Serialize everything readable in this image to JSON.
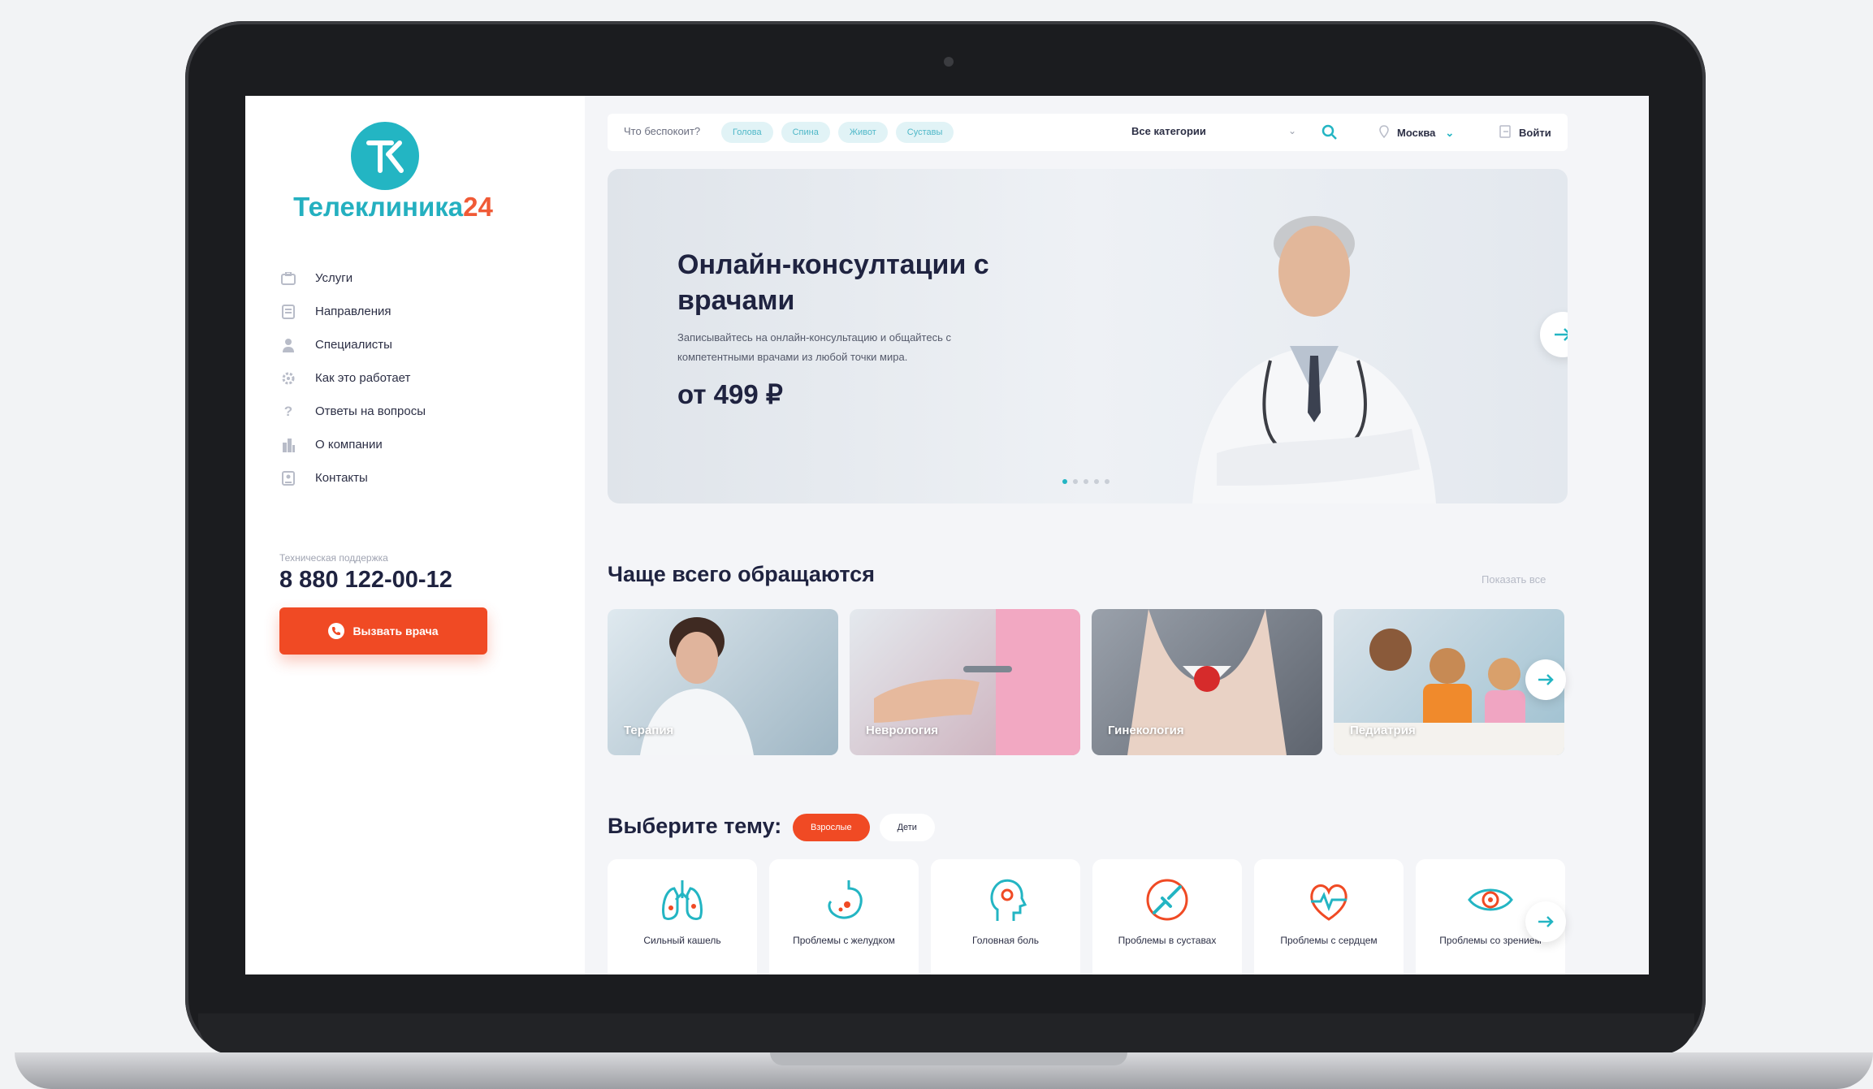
{
  "brand": {
    "name_main": "Телеклиника",
    "name_accent": "24",
    "teal": "#23b5c3",
    "orange": "#f04a24"
  },
  "sidebar": {
    "items": [
      {
        "label": "Услуги",
        "icon": "services-icon"
      },
      {
        "label": "Направления",
        "icon": "document-icon"
      },
      {
        "label": "Специалисты",
        "icon": "person-icon"
      },
      {
        "label": "Как это работает",
        "icon": "gear-icon"
      },
      {
        "label": "Ответы на вопросы",
        "icon": "question-icon"
      },
      {
        "label": "О компании",
        "icon": "building-icon"
      },
      {
        "label": "Контакты",
        "icon": "contacts-icon"
      }
    ],
    "support_label": "Техническая поддержка",
    "phone": "8 880 122-00-12",
    "call_button": "Вызвать врача"
  },
  "header": {
    "search_prompt": "Что беспокоит?",
    "chips": [
      "Голова",
      "Спина",
      "Живот",
      "Суставы"
    ],
    "category": "Все категории",
    "city": "Москва",
    "login": "Войти"
  },
  "hero": {
    "title": "Онлайн-консултации с врачами",
    "text": "Записывайтесь на онлайн-консультацию и общайтесь с компетентными врачами из любой точки мира.",
    "price": "от 499 ₽",
    "slides": 5,
    "active_slide": 1
  },
  "popular": {
    "title": "Чаще всего обращаются",
    "show_all": "Показать все",
    "cards": [
      "Терапия",
      "Неврология",
      "Гинекология",
      "Педиатрия"
    ]
  },
  "topics": {
    "title": "Выберите тему:",
    "tabs": [
      "Взрослые",
      "Дети"
    ],
    "active_tab": "Взрослые",
    "items": [
      {
        "label": "Сильный кашель",
        "icon": "lungs-icon"
      },
      {
        "label": "Проблемы с желудком",
        "icon": "stomach-icon"
      },
      {
        "label": "Головная боль",
        "icon": "head-icon"
      },
      {
        "label": "Проблемы в суставах",
        "icon": "joint-icon"
      },
      {
        "label": "Проблемы с сердцем",
        "icon": "heart-icon"
      },
      {
        "label": "Проблемы со зрением",
        "icon": "eye-icon"
      }
    ]
  }
}
